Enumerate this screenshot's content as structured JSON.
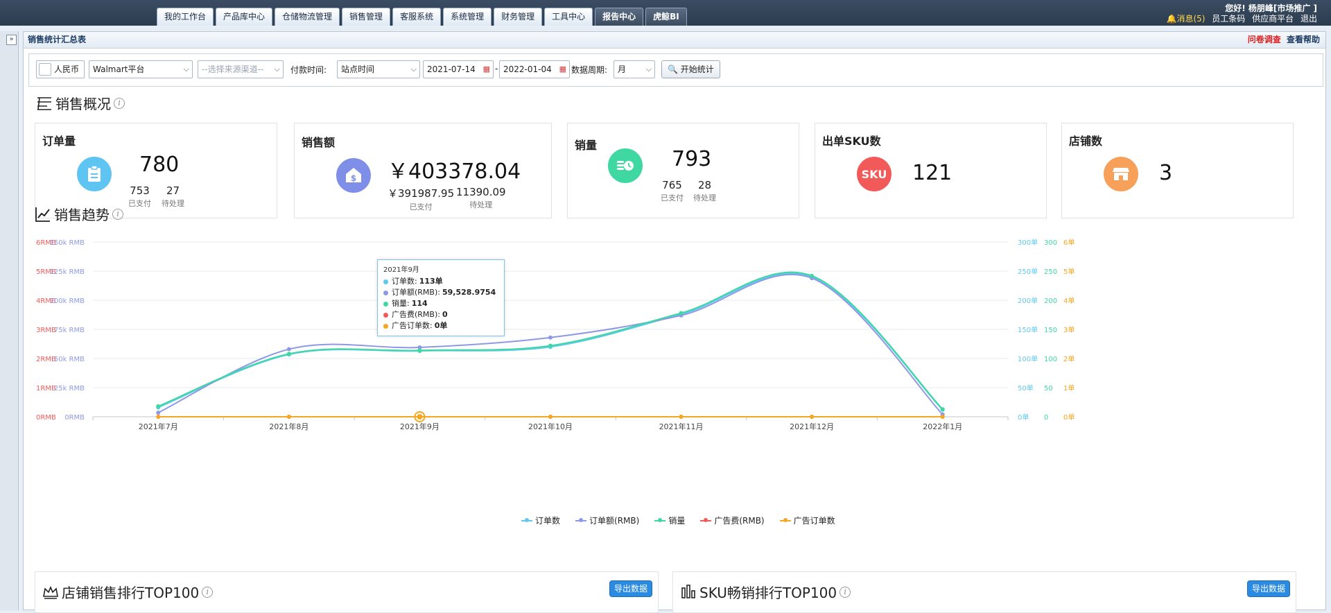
{
  "nav": {
    "tabs": [
      "我的工作台",
      "产品库中心",
      "仓储物流管理",
      "销售管理",
      "客服系统",
      "系统管理",
      "财务管理",
      "工具中心",
      "报告中心",
      "虎鲸BI"
    ],
    "active": [
      8,
      9
    ]
  },
  "user": {
    "greeting": "您好! 杨朋峰[市场推广 ]",
    "message": "消息(5)",
    "links": [
      "员工条码",
      "供应商平台",
      "退出"
    ]
  },
  "page": {
    "title": "销售统计汇总表",
    "survey_link": "问卷调查",
    "help_link": "查看帮助"
  },
  "filters": {
    "currency": "人民币",
    "platform": "Walmart平台",
    "channel_placeholder": "--选择来源渠道--",
    "pay_time_label": "付款时间:",
    "time_type": "站点时间",
    "start_date": "2021-07-14",
    "date_sep": "-",
    "end_date": "2022-01-04",
    "period_label": "数据周期:",
    "period": "月",
    "start_button": "开始统计"
  },
  "overview": {
    "title": "销售概况",
    "cards": {
      "orders": {
        "title": "订单量",
        "total": "780",
        "paid": "753",
        "paid_label": "已支付",
        "pending": "27",
        "pending_label": "待处理"
      },
      "sales": {
        "title": "销售额",
        "total": "￥403378.04",
        "paid": "￥391987.95",
        "paid_label": "已支付",
        "pending": "11390.09",
        "pending_label": "待处理"
      },
      "volume": {
        "title": "销量",
        "total": "793",
        "paid": "765",
        "paid_label": "已支付",
        "pending": "28",
        "pending_label": "待处理"
      },
      "sku": {
        "title": "出单SKU数",
        "total": "121",
        "icon_text": "SKU"
      },
      "shops": {
        "title": "店铺数",
        "total": "3"
      }
    }
  },
  "trend": {
    "title": "销售趋势"
  },
  "chart_data": {
    "type": "line",
    "categories": [
      "2021年7月",
      "2021年8月",
      "2021年9月",
      "2021年10月",
      "2021年11月",
      "2021年12月",
      "2022年1月"
    ],
    "series": [
      {
        "name": "订单数",
        "color": "#5fc9ec",
        "axis": "right1",
        "values": [
          16,
          107,
          113,
          120,
          176,
          240,
          12
        ]
      },
      {
        "name": "订单额(RMB)",
        "color": "#8e99e6",
        "axis": "left2",
        "values": [
          3500,
          58000,
          59528.9754,
          68000,
          87000,
          119000,
          2000
        ]
      },
      {
        "name": "销量",
        "color": "#3fd8a2",
        "axis": "right2",
        "values": [
          18,
          108,
          114,
          122,
          178,
          242,
          13
        ]
      },
      {
        "name": "广告费(RMB)",
        "color": "#f25a5a",
        "axis": "left1",
        "values": [
          0,
          0,
          0,
          0,
          0,
          0,
          0
        ]
      },
      {
        "name": "广告订单数",
        "color": "#f5a623",
        "axis": "right3",
        "values": [
          0,
          0,
          0,
          0,
          0,
          0,
          0
        ]
      }
    ],
    "axes": {
      "left1": {
        "ticks": [
          "0RMB",
          "1RMB",
          "2RMB",
          "3RMB",
          "4RMB",
          "5RMB",
          "6RMB"
        ],
        "color": "#f25a5a",
        "max": 6
      },
      "left2": {
        "ticks": [
          "0RMB",
          "25k RMB",
          "50k RMB",
          "75k RMB",
          "100k RMB",
          "125k RMB",
          "150k RMB"
        ],
        "color": "#8e99e6",
        "max": 150000
      },
      "right1": {
        "ticks": [
          "0单",
          "50单",
          "100单",
          "150单",
          "200单",
          "250单",
          "300单"
        ],
        "color": "#5fc9ec",
        "max": 300
      },
      "right2": {
        "ticks": [
          "0",
          "50",
          "100",
          "150",
          "200",
          "250",
          "300"
        ],
        "color": "#3fd8a2",
        "max": 300
      },
      "right3": {
        "ticks": [
          "0单",
          "1单",
          "2单",
          "3单",
          "4单",
          "5单",
          "6单"
        ],
        "color": "#f5a623",
        "max": 6
      }
    },
    "tooltip": {
      "title": "2021年9月",
      "rows": [
        {
          "label": "订单数:",
          "value": "113单",
          "color": "#5fc9ec"
        },
        {
          "label": "订单额(RMB):",
          "value": "59,528.9754",
          "color": "#8e99e6"
        },
        {
          "label": "销量:",
          "value": "114",
          "color": "#3fd8a2"
        },
        {
          "label": "广告费(RMB):",
          "value": "0",
          "color": "#f25a5a"
        },
        {
          "label": "广告订单数:",
          "value": "0单",
          "color": "#f5a623"
        }
      ]
    },
    "legend_position": "bottom"
  },
  "panels": {
    "shop_rank": {
      "title": "店铺销售排行TOP100",
      "export": "导出数据"
    },
    "sku_rank": {
      "title": "SKU畅销排行TOP100",
      "export": "导出数据"
    }
  }
}
